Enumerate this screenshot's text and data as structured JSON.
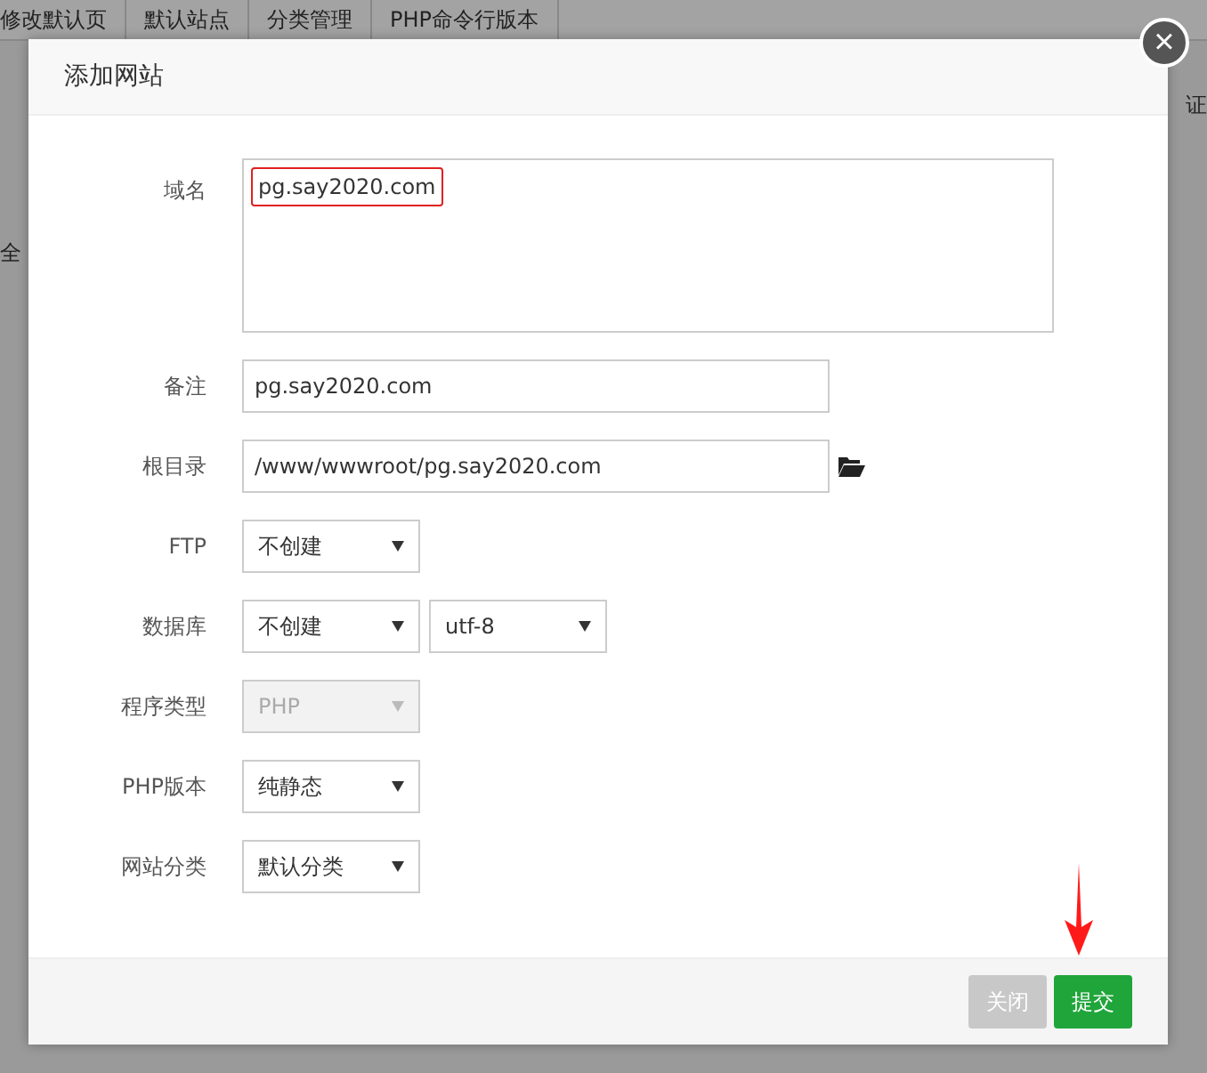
{
  "background": {
    "tabs": [
      "修改默认页",
      "默认站点",
      "分类管理",
      "PHP命令行版本"
    ],
    "right_edge_text": "证",
    "left_edge_text": "全"
  },
  "dialog": {
    "title": "添加网站",
    "close_glyph": "×",
    "fields": [
      {
        "kind": "textarea",
        "label": "域名",
        "value": "pg.say2020.com",
        "highlighted": true
      },
      {
        "kind": "input",
        "label": "备注",
        "value": "pg.say2020.com"
      },
      {
        "kind": "browse",
        "label": "根目录",
        "value": "/www/wwwroot/pg.say2020.com"
      },
      {
        "kind": "select",
        "label": "FTP",
        "values": [
          "不创建"
        ],
        "disabled": false
      },
      {
        "kind": "select",
        "label": "数据库",
        "values": [
          "不创建",
          "utf-8"
        ],
        "disabled": false
      },
      {
        "kind": "select",
        "label": "程序类型",
        "values": [
          "PHP"
        ],
        "disabled": true
      },
      {
        "kind": "select",
        "label": "PHP版本",
        "values": [
          "纯静态"
        ],
        "disabled": false
      },
      {
        "kind": "select",
        "label": "网站分类",
        "values": [
          "默认分类"
        ],
        "disabled": false
      }
    ],
    "buttons": [
      {
        "kind": "secondary",
        "label": "关闭"
      },
      {
        "kind": "primary",
        "label": "提交"
      }
    ],
    "pointer_arrow": true
  }
}
